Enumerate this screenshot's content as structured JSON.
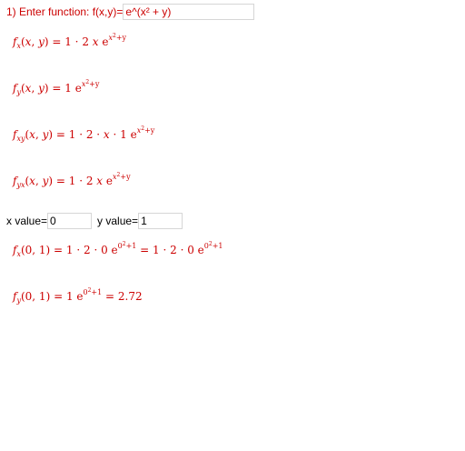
{
  "function_prompt": {
    "label": "1) Enter function: f(x,y)=",
    "value": "e^(x² + y)"
  },
  "derivatives": {
    "fx": {
      "name": "x",
      "rhs_num": "1 · 2",
      "rhs_var": "x",
      "base": "e",
      "exp_x": "x",
      "exp_sq": "2",
      "exp_rest": "+y"
    },
    "fy": {
      "name": "y",
      "rhs_num": "1",
      "base": "e",
      "exp_x": "x",
      "exp_sq": "2",
      "exp_rest": "+y"
    },
    "fxy": {
      "name": "xy",
      "rhs_num": "1 · 2",
      "rhs_var": "x",
      "rhs_tail": "· 1",
      "base": "e",
      "exp_x": "x",
      "exp_sq": "2",
      "exp_rest": "+y"
    },
    "fyx": {
      "name": "yx",
      "rhs_num": "1 · 2",
      "rhs_var": "x",
      "base": "e",
      "exp_x": "x",
      "exp_sq": "2",
      "exp_rest": "+y"
    }
  },
  "point_inputs": {
    "x_label": "x value=",
    "x_value": "0",
    "y_label": "y value=",
    "y_value": "1"
  },
  "evaluations": {
    "fx_at": {
      "name": "x",
      "args": "(0, 1)",
      "expanded": "1 · 2 · 0",
      "exp": "0",
      "exp_sq": "2",
      "exp_rest": "+1",
      "simplified": "1 · 2 · 0"
    },
    "fy_at": {
      "name": "y",
      "args": "(0, 1)",
      "coef": "1",
      "exp": "0",
      "exp_sq": "2",
      "exp_rest": "+1",
      "result": "2.72"
    }
  }
}
